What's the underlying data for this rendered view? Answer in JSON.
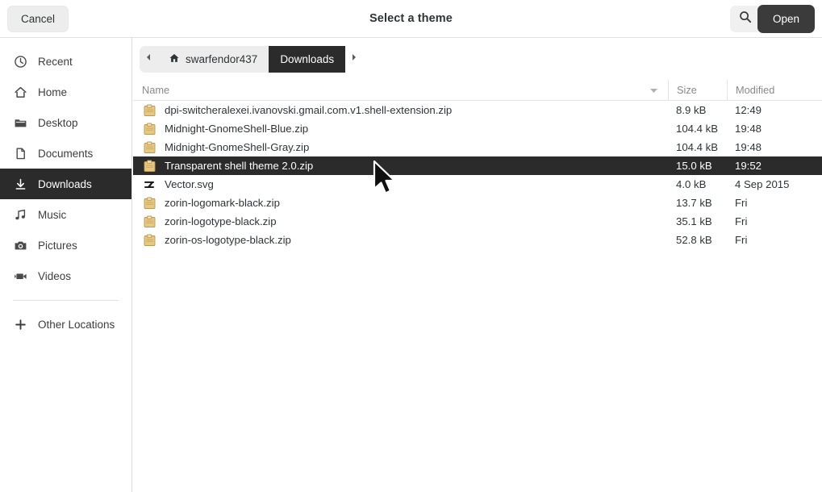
{
  "header": {
    "title": "Select a theme",
    "cancel_label": "Cancel",
    "open_label": "Open",
    "search_icon": "search-icon"
  },
  "sidebar": {
    "items": [
      {
        "label": "Recent",
        "icon": "clock-icon",
        "selected": false
      },
      {
        "label": "Home",
        "icon": "home-icon",
        "selected": false
      },
      {
        "label": "Desktop",
        "icon": "folder-icon",
        "selected": false
      },
      {
        "label": "Documents",
        "icon": "document-icon",
        "selected": false
      },
      {
        "label": "Downloads",
        "icon": "download-icon",
        "selected": true
      },
      {
        "label": "Music",
        "icon": "music-note-icon",
        "selected": false
      },
      {
        "label": "Pictures",
        "icon": "camera-icon",
        "selected": false
      },
      {
        "label": "Videos",
        "icon": "video-camera-icon",
        "selected": false
      }
    ],
    "other_locations": {
      "label": "Other Locations",
      "icon": "plus-icon"
    }
  },
  "pathbar": {
    "back_icon": "chevron-left-icon",
    "forward_icon": "chevron-right-icon",
    "crumbs": [
      {
        "label": "swarfendor437",
        "icon": "home-icon",
        "active": false
      },
      {
        "label": "Downloads",
        "icon": "",
        "active": true
      }
    ]
  },
  "filelist": {
    "columns": {
      "name": "Name",
      "size": "Size",
      "modified": "Modified",
      "sort_icon": "sort-descending-icon"
    },
    "rows": [
      {
        "name": "dpi-switcheralexei.ivanovski.gmail.com.v1.shell-extension.zip",
        "size": "8.9 kB",
        "modified": "12:49",
        "icon": "archive-icon",
        "selected": false
      },
      {
        "name": "Midnight-GnomeShell-Blue.zip",
        "size": "104.4 kB",
        "modified": "19:48",
        "icon": "archive-icon",
        "selected": false
      },
      {
        "name": "Midnight-GnomeShell-Gray.zip",
        "size": "104.4 kB",
        "modified": "19:48",
        "icon": "archive-icon",
        "selected": false
      },
      {
        "name": "Transparent shell theme 2.0.zip",
        "size": "15.0 kB",
        "modified": "19:52",
        "icon": "archive-icon",
        "selected": true
      },
      {
        "name": "Vector.svg",
        "size": "4.0 kB",
        "modified": "4 Sep 2015",
        "icon": "zorin-logo-icon",
        "selected": false
      },
      {
        "name": "zorin-logomark-black.zip",
        "size": "13.7 kB",
        "modified": "Fri",
        "icon": "archive-icon",
        "selected": false
      },
      {
        "name": "zorin-logotype-black.zip",
        "size": "35.1 kB",
        "modified": "Fri",
        "icon": "archive-icon",
        "selected": false
      },
      {
        "name": "zorin-os-logotype-black.zip",
        "size": "52.8 kB",
        "modified": "Fri",
        "icon": "archive-icon",
        "selected": false
      }
    ]
  },
  "colors": {
    "selection": "#2b2b2b",
    "accent_button": "#3b3b3b",
    "button_bg": "#ededed",
    "archive_icon": "#e8c77e"
  },
  "cursor": {
    "icon": "arrow-cursor"
  }
}
